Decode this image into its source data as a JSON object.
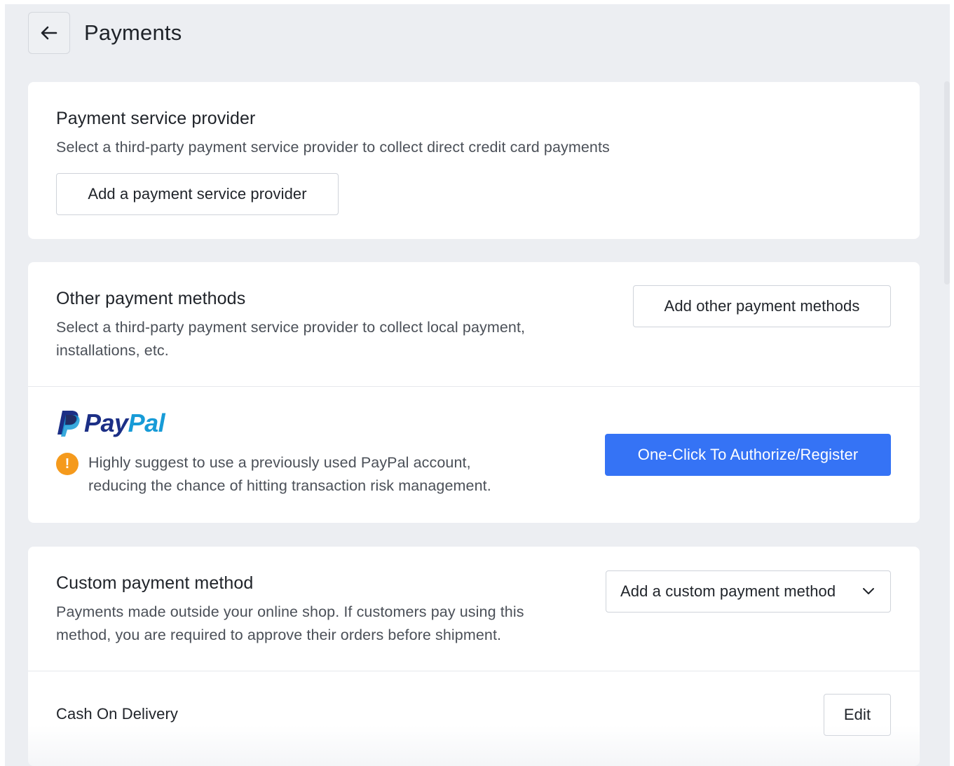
{
  "header": {
    "title": "Payments",
    "back_icon": "arrow-left-icon"
  },
  "payment_service_provider": {
    "title": "Payment service provider",
    "description": "Select a third-party payment service provider to collect direct credit card payments",
    "add_button": "Add a payment service provider"
  },
  "other_payment_methods": {
    "title": "Other payment methods",
    "description_line1": "Select a third-party payment service provider to collect local payment,",
    "description_line2": "installations, etc.",
    "add_button": "Add other payment methods",
    "paypal": {
      "logo_text_pay": "Pay",
      "logo_text_pal": "Pal",
      "warning_icon": "exclamation-icon",
      "warning_line1": "Highly suggest to use a previously used PayPal account,",
      "warning_line2": "reducing the chance of hitting transaction risk management.",
      "authorize_button": "One-Click To Authorize/Register"
    }
  },
  "custom_payment_method": {
    "title": "Custom payment method",
    "description_line1": "Payments made outside your online shop. If customers pay using this",
    "description_line2": "method, you are required to approve their orders before shipment.",
    "add_select": "Add a custom payment method",
    "add_select_icon": "chevron-down-icon",
    "methods": [
      {
        "name": "Cash On Delivery",
        "edit_label": "Edit"
      }
    ]
  },
  "colors": {
    "primary": "#3573f5",
    "warning": "#f59a1c",
    "paypal_dark": "#1c2f86",
    "paypal_light": "#179bd7",
    "page_bg": "#eceef2"
  }
}
